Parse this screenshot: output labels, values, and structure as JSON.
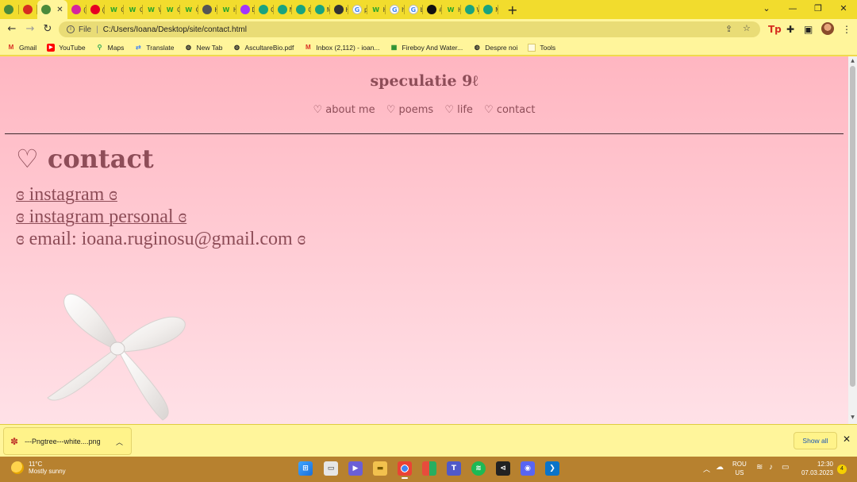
{
  "browser": {
    "tabs": [
      {
        "label": "",
        "icon": "chrome-icon",
        "color": "#4a8a3a"
      },
      {
        "label": "",
        "icon": "red-bookmark-icon",
        "color": "#d62d20"
      },
      {
        "label": "",
        "icon": "chrome-icon",
        "color": "#4a8a3a",
        "active": true
      },
      {
        "label": "(2",
        "icon": "instagram-icon",
        "color": "#d6249f"
      },
      {
        "label": "(1",
        "icon": "pinterest-icon",
        "color": "#e60023"
      },
      {
        "label": "C",
        "icon": "wattpad-w-icon",
        "color": "#2aa52a"
      },
      {
        "label": "C",
        "icon": "wattpad-w-icon",
        "color": "#2aa52a"
      },
      {
        "label": "W",
        "icon": "wattpad-w-icon",
        "color": "#2aa52a"
      },
      {
        "label": "C",
        "icon": "wattpad-w-icon",
        "color": "#2aa52a"
      },
      {
        "label": "C",
        "icon": "wattpad-w-icon",
        "color": "#2aa52a"
      },
      {
        "label": "H",
        "icon": "globe-icon",
        "color": "#555555"
      },
      {
        "label": "H",
        "icon": "wattpad-w-icon",
        "color": "#2aa52a"
      },
      {
        "label": "D",
        "icon": "messenger-icon",
        "color": "#a334fa"
      },
      {
        "label": "C",
        "icon": "chatgpt-icon",
        "color": "#19a37f"
      },
      {
        "label": "M",
        "icon": "chatgpt-icon",
        "color": "#19a37f"
      },
      {
        "label": "C",
        "icon": "chatgpt-icon",
        "color": "#19a37f"
      },
      {
        "label": "M",
        "icon": "chatgpt-icon",
        "color": "#19a37f"
      },
      {
        "label": "H",
        "icon": "infinity-icon",
        "color": "#333333"
      },
      {
        "label": "p",
        "icon": "google-icon",
        "color": "#ffffff"
      },
      {
        "label": "H",
        "icon": "wattpad-w-icon",
        "color": "#2aa52a"
      },
      {
        "label": "hi",
        "icon": "google-icon",
        "color": "#ffffff"
      },
      {
        "label": "bi",
        "icon": "google-icon",
        "color": "#ffffff"
      },
      {
        "label": "#",
        "icon": "tiktok-icon",
        "color": "#111111"
      },
      {
        "label": "H",
        "icon": "wattpad-w-icon",
        "color": "#2aa52a"
      },
      {
        "label": "W",
        "icon": "chatgpt-icon",
        "color": "#19a37f"
      },
      {
        "label": "M",
        "icon": "chatgpt-icon",
        "color": "#19a37f"
      }
    ],
    "new_tab": "+",
    "window_controls": {
      "dropdown": "⌄",
      "minimize": "—",
      "restore": "❐",
      "close": "✕"
    },
    "address": {
      "scheme": "File",
      "url": "C:/Users/Ioana/Desktop/site/contact.html"
    },
    "bookmarks": [
      {
        "label": "Gmail",
        "icon": "gmail-icon",
        "color": "#d93025"
      },
      {
        "label": "YouTube",
        "icon": "youtube-icon",
        "color": "#ff0000"
      },
      {
        "label": "Maps",
        "icon": "maps-pin-icon",
        "color": "#34a853"
      },
      {
        "label": "Translate",
        "icon": "translate-icon",
        "color": "#4285f4"
      },
      {
        "label": "New Tab",
        "icon": "globe-icon",
        "color": "#222222"
      },
      {
        "label": "AscultareBio.pdf",
        "icon": "globe-icon",
        "color": "#222222"
      },
      {
        "label": "Inbox (2,112) - ioan...",
        "icon": "gmail-icon",
        "color": "#d93025"
      },
      {
        "label": "Fireboy And Water...",
        "icon": "game-icon",
        "color": "#1d8a2b"
      },
      {
        "label": "Despre noi",
        "icon": "globe-icon",
        "color": "#222222"
      },
      {
        "label": "Tools",
        "icon": "folder-icon",
        "color": "#f5f5dc"
      }
    ]
  },
  "page": {
    "site_title": "speculatie 9ℓ",
    "nav": [
      "♡ about me",
      "♡ poems",
      "♡ life",
      "♡ contact"
    ],
    "heading": "♡ contact",
    "links": [
      {
        "text": "ɞ instagram ɞ",
        "is_link": true
      },
      {
        "text": "ɞ instagram personal ɞ",
        "is_link": true
      },
      {
        "text": "ɞ email: ioana.ruginosu@gmail.com ɞ",
        "is_link": false
      }
    ]
  },
  "download_bar": {
    "filename": "---Pngtree---white....png",
    "show_all": "Show all",
    "close": "✕"
  },
  "taskbar": {
    "weather_temp": "11°C",
    "weather_text": "Mostly sunny",
    "language": "ROU",
    "region": "US",
    "time": "12:30",
    "date": "07.03.2023",
    "notifications": "4"
  },
  "colors": {
    "accent_text": "#8e4d58",
    "chrome_theme": "#fff59b",
    "page_top": "#ffb6c1",
    "page_bottom": "#ffe1e7"
  }
}
